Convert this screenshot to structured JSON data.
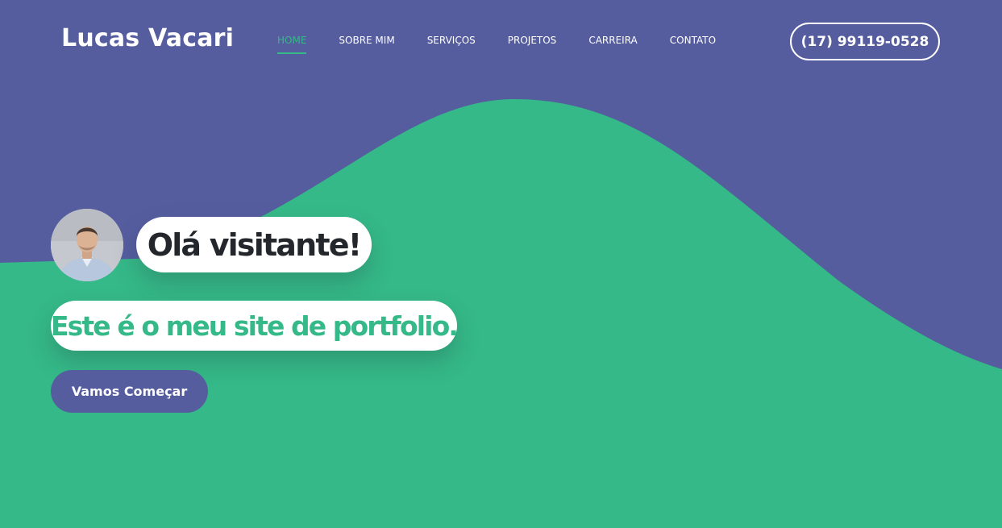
{
  "colors": {
    "primary": "#555d9f",
    "accent": "#35b988",
    "white": "#ffffff",
    "dark_text": "#23262b"
  },
  "header": {
    "logo": "Lucas Vacari",
    "nav": [
      {
        "label": "HOME",
        "active": true
      },
      {
        "label": "SOBRE MIM",
        "active": false
      },
      {
        "label": "SERVIÇOS",
        "active": false
      },
      {
        "label": "PROJETOS",
        "active": false
      },
      {
        "label": "CARREIRA",
        "active": false
      },
      {
        "label": "CONTATO",
        "active": false
      }
    ],
    "phone": "(17) 99119-0528"
  },
  "hero": {
    "avatar_icon": "profile-photo",
    "greeting": "Olá visitante!",
    "intro": "Este é o meu site de portfolio.",
    "cta": "Vamos Começar"
  }
}
